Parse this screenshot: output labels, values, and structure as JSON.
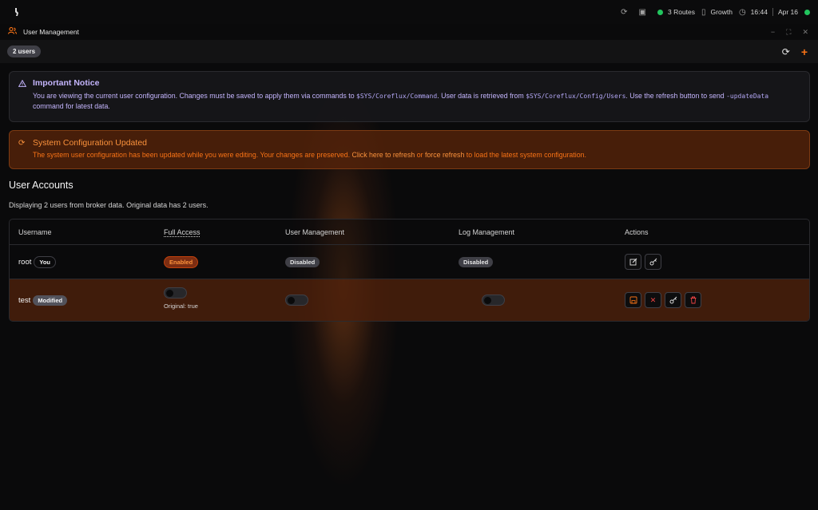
{
  "topbar": {
    "routes": "3 Routes",
    "plan": "Growth",
    "time": "16:44",
    "date": "Apr 16"
  },
  "window": {
    "title": "User Management"
  },
  "toolbar": {
    "user_count": "2 users"
  },
  "notice": {
    "title": "Important Notice",
    "text_1": "You are viewing the current user configuration. Changes must be saved to apply them via commands to ",
    "cmd_topic": "$SYS/Coreflux/Command",
    "text_2": ". User data is retrieved from ",
    "config_topic": "$SYS/Coreflux/Config/Users",
    "text_3": ". Use the refresh button to send ",
    "update_cmd": "-updateData",
    "text_4": " command for latest data."
  },
  "warning": {
    "title": "System Configuration Updated",
    "text_1": "The system user configuration has been updated while you were editing. Your changes are preserved. ",
    "link_refresh": "Click here to refresh",
    "text_2": " or ",
    "link_force": "force refresh",
    "text_3": " to load the latest system configuration."
  },
  "accounts": {
    "title": "User Accounts",
    "subtitle": "Displaying 2 users from broker data. Original data has 2 users."
  },
  "table": {
    "headers": [
      "Username",
      "Full Access",
      "User Management",
      "Log Management",
      "Actions"
    ],
    "rows": [
      {
        "username": "root",
        "badge": "You",
        "full_access": "Enabled",
        "user_management": "Disabled",
        "log_management": "Disabled"
      },
      {
        "username": "test",
        "badge": "Modified",
        "full_access": false,
        "full_access_original": "Original: true",
        "user_management": false,
        "log_management": false
      }
    ]
  },
  "colors": {
    "accent": "#f97316",
    "notice": "#c4b5fd",
    "online": "#22c55e"
  }
}
